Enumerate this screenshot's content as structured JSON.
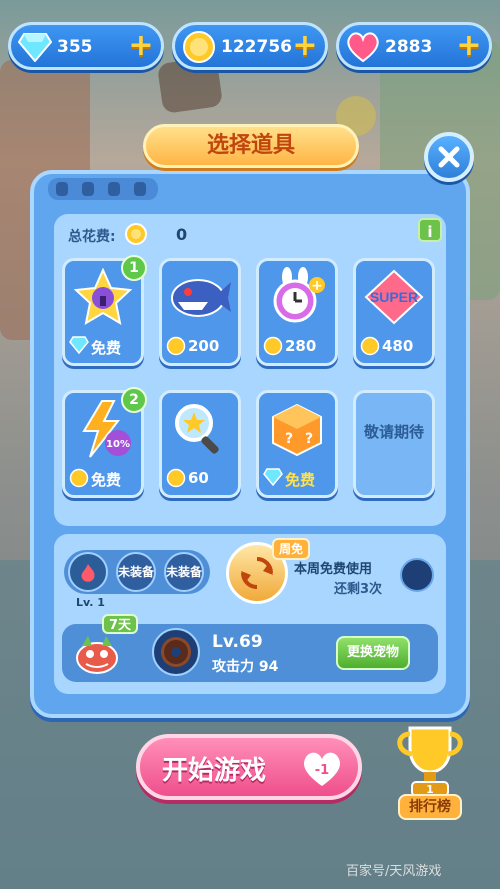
{
  "currency": {
    "gems": "355",
    "coins": "122756",
    "hearts": "2883"
  },
  "panel": {
    "title": "选择道具",
    "total_cost_label": "总花费:",
    "total_cost_value": "0",
    "info_label": "i"
  },
  "items": [
    {
      "name": "star-lock",
      "price": "免费",
      "currency": "gem",
      "badge": "1"
    },
    {
      "name": "shark",
      "price": "200",
      "currency": "coin"
    },
    {
      "name": "clock-plus",
      "price": "280",
      "currency": "coin"
    },
    {
      "name": "super",
      "price": "480",
      "currency": "coin",
      "art_text": "SUPER"
    },
    {
      "name": "lightning",
      "price": "免费",
      "currency": "coin",
      "badge": "2",
      "art_text": "10%"
    },
    {
      "name": "magnifier",
      "price": "60",
      "currency": "coin"
    },
    {
      "name": "mystery-box",
      "price": "免费",
      "currency": "gem"
    },
    {
      "name": "coming-soon",
      "label": "敬请期待"
    }
  ],
  "equip": {
    "slot_level": "Lv. 1",
    "slot2": "未装备",
    "slot3": "未装备",
    "weekly_badge": "周免",
    "weekly_text": "本周免费使用",
    "weekly_remaining": "还剩3次"
  },
  "pet": {
    "days": "7天",
    "level": "Lv.69",
    "attack": "攻击力 94",
    "change_label": "更换宠物"
  },
  "start": {
    "label": "开始游戏",
    "cost": "-1"
  },
  "ranking": {
    "rank": "1",
    "label": "排行榜"
  },
  "watermark": "百家号/天风游戏"
}
